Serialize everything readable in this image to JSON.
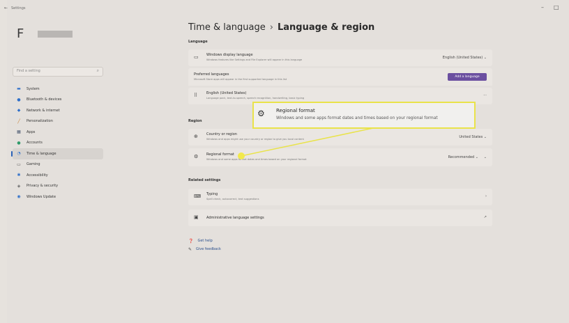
{
  "app": {
    "title": "Settings",
    "back": "←"
  },
  "window_controls": {
    "minimize": "–",
    "maximize": "□"
  },
  "sidebar": {
    "search_placeholder": "Find a setting",
    "items": [
      {
        "label": "System",
        "icon": "monitor-icon"
      },
      {
        "label": "Bluetooth & devices",
        "icon": "bluetooth-icon"
      },
      {
        "label": "Network & internet",
        "icon": "wifi-icon"
      },
      {
        "label": "Personalization",
        "icon": "brush-icon"
      },
      {
        "label": "Apps",
        "icon": "apps-icon"
      },
      {
        "label": "Accounts",
        "icon": "person-icon"
      },
      {
        "label": "Time & language",
        "icon": "clock-icon",
        "active": true
      },
      {
        "label": "Gaming",
        "icon": "gamepad-icon"
      },
      {
        "label": "Accessibility",
        "icon": "accessibility-icon"
      },
      {
        "label": "Privacy & security",
        "icon": "shield-icon"
      },
      {
        "label": "Windows Update",
        "icon": "update-icon"
      }
    ]
  },
  "breadcrumb": {
    "parent": "Time & language",
    "separator": "›",
    "current": "Language & region"
  },
  "language": {
    "section_title": "Language",
    "display": {
      "title": "Windows display language",
      "desc": "Windows features like Settings and File Explorer will appear in this language",
      "value": "English (United States)"
    },
    "preferred": {
      "title": "Preferred languages",
      "desc": "Microsoft Store apps will appear in the first supported language in this list",
      "button": "Add a language"
    },
    "english": {
      "title": "English (United States)",
      "desc": "Language pack, text-to-speech, speech recognition, handwriting, basic typing",
      "more": "···"
    }
  },
  "region": {
    "section_title": "Region",
    "country": {
      "title": "Country or region",
      "desc": "Windows and apps might use your country or region to give you local content",
      "value": "United States"
    },
    "format": {
      "title": "Regional format",
      "desc": "Windows and some apps format dates and times based on your regional format",
      "value": "Recommended"
    }
  },
  "related": {
    "section_title": "Related settings",
    "typing": {
      "title": "Typing",
      "desc": "Spell check, autocorrect, text suggestions"
    },
    "admin": {
      "title": "Administrative language settings"
    }
  },
  "help": {
    "get_help": "Get help",
    "feedback": "Give feedback"
  },
  "callout": {
    "title": "Regional format",
    "desc": "Windows and some apps format dates and times based on your regional format"
  },
  "colors": {
    "accent": "#6b4fa0",
    "highlight": "#e9e34a",
    "nav_active": "#2b62b8"
  }
}
